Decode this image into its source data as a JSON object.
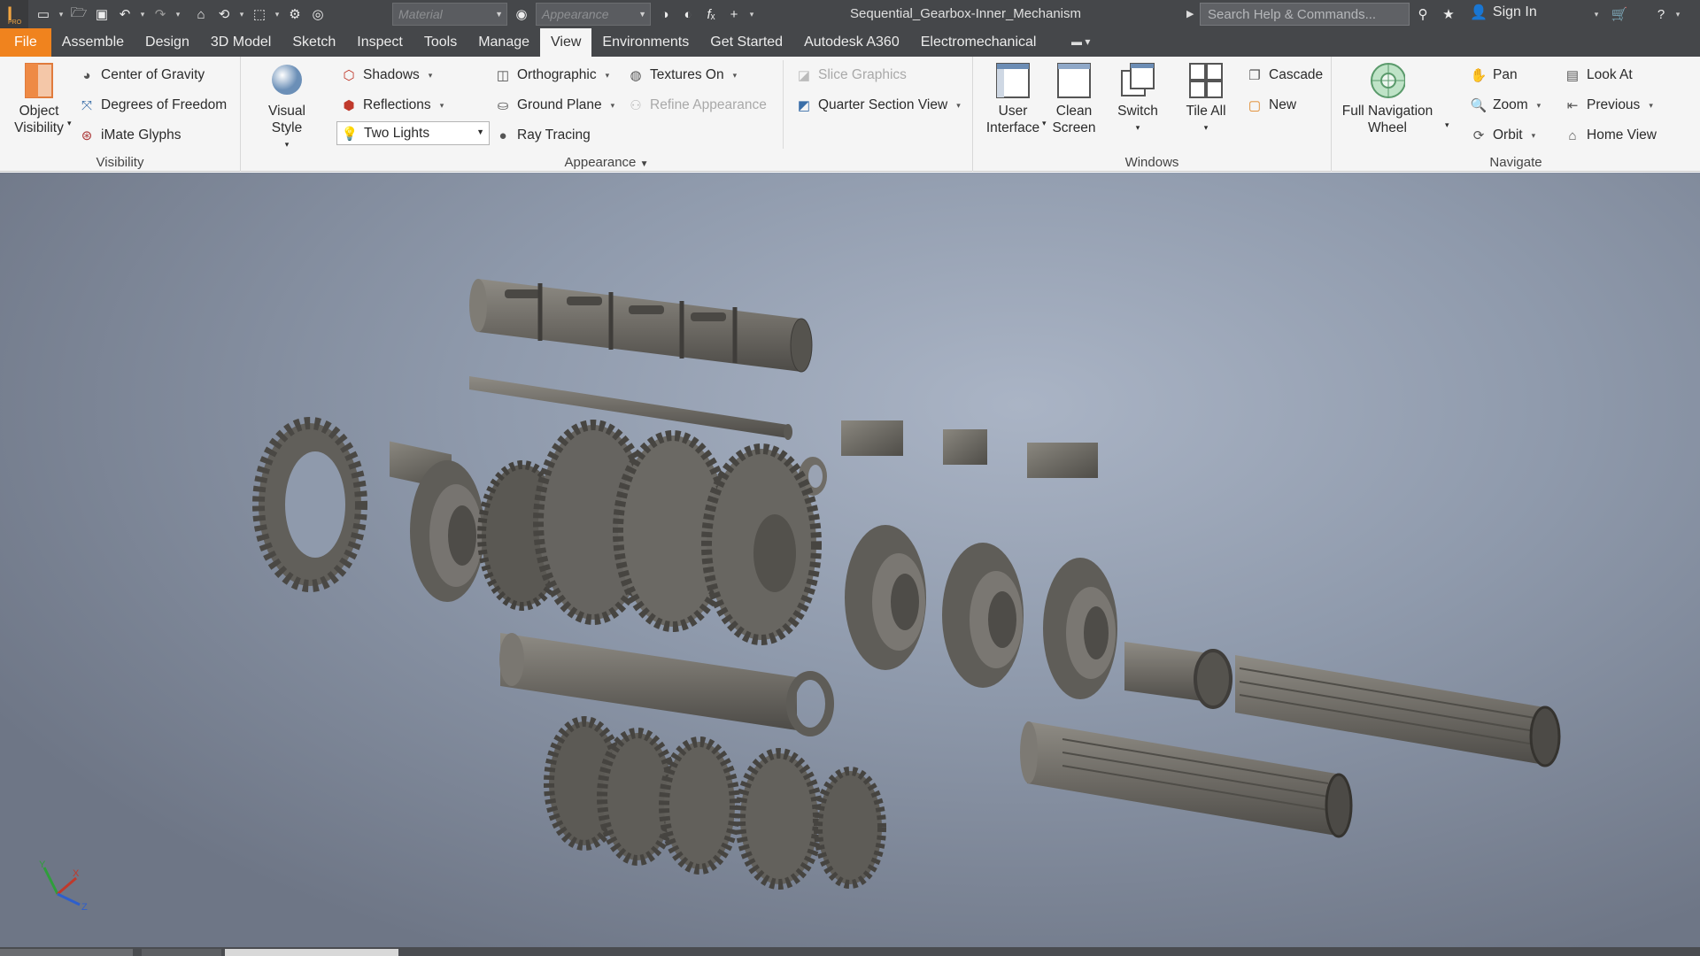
{
  "titlebar": {
    "logo_letter": "I",
    "logo_sub": "PRO",
    "material_placeholder": "Material",
    "appearance_placeholder": "Appearance",
    "document_title": "Sequential_Gearbox-Inner_Mechanism",
    "search_placeholder": "Search Help & Commands...",
    "sign_in": "Sign In"
  },
  "tabs": [
    "File",
    "Assemble",
    "Design",
    "3D Model",
    "Sketch",
    "Inspect",
    "Tools",
    "Manage",
    "View",
    "Environments",
    "Get Started",
    "Autodesk A360",
    "Electromechanical"
  ],
  "active_tab": "View",
  "ribbon": {
    "visibility": {
      "label": "Visibility",
      "object_visibility": "Object\nVisibility",
      "center_of_gravity": "Center of Gravity",
      "degrees_of_freedom": "Degrees of Freedom",
      "imate_glyphs": "iMate Glyphs"
    },
    "appearance": {
      "label": "Appearance",
      "visual_style": "Visual Style",
      "shadows": "Shadows",
      "reflections": "Reflections",
      "lighting": "Two Lights",
      "orthographic": "Orthographic",
      "ground_plane": "Ground Plane",
      "ray_tracing": "Ray Tracing",
      "textures_on": "Textures On",
      "refine_appearance": "Refine Appearance",
      "slice_graphics": "Slice Graphics",
      "quarter_section_view": "Quarter Section View"
    },
    "windows": {
      "label": "Windows",
      "user_interface": "User\nInterface",
      "clean_screen": "Clean\nScreen",
      "switch": "Switch",
      "tile_all": "Tile All",
      "cascade": "Cascade",
      "new": "New"
    },
    "navigate": {
      "label": "Navigate",
      "full_navigation_wheel": "Full Navigation\nWheel",
      "pan": "Pan",
      "zoom": "Zoom",
      "orbit": "Orbit",
      "look_at": "Look At",
      "previous": "Previous",
      "home_view": "Home View"
    }
  },
  "viewport": {
    "axis_labels": [
      "X",
      "Y",
      "Z"
    ]
  },
  "colors": {
    "accent": "#f0831e",
    "titlebar": "#45474a",
    "ribbon": "#f5f5f5",
    "part_metal": "#6d6b66"
  }
}
